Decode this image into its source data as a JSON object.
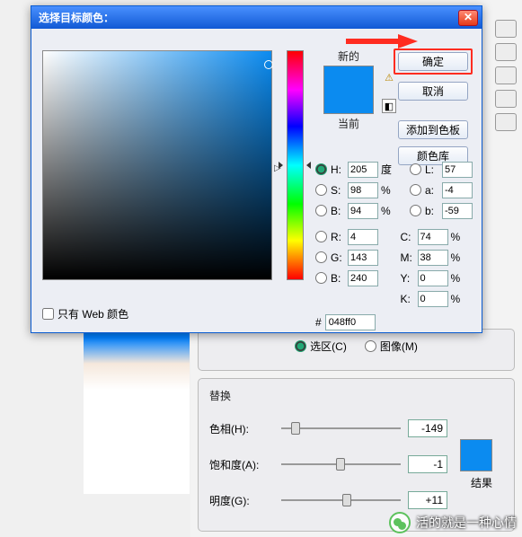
{
  "dialog": {
    "title": "选择目标颜色：",
    "ok": "确定",
    "cancel": "取消",
    "add_swatch": "添加到色板",
    "color_lib": "颜色库",
    "new_label": "新的",
    "current_label": "当前",
    "web_only": "只有 Web 颜色",
    "hex_prefix": "#",
    "hex_value": "048ff0",
    "hsb": {
      "h": {
        "label": "H:",
        "value": "205",
        "unit": "度"
      },
      "s": {
        "label": "S:",
        "value": "98",
        "unit": "%"
      },
      "b": {
        "label": "B:",
        "value": "94",
        "unit": "%"
      }
    },
    "lab": {
      "l": {
        "label": "L:",
        "value": "57"
      },
      "a": {
        "label": "a:",
        "value": "-4"
      },
      "b": {
        "label": "b:",
        "value": "-59"
      }
    },
    "rgb": {
      "r": {
        "label": "R:",
        "value": "4"
      },
      "g": {
        "label": "G:",
        "value": "143"
      },
      "b": {
        "label": "B:",
        "value": "240"
      }
    },
    "cmyk": {
      "c": {
        "label": "C:",
        "value": "74",
        "unit": "%"
      },
      "m": {
        "label": "M:",
        "value": "38",
        "unit": "%"
      },
      "y": {
        "label": "Y:",
        "value": "0",
        "unit": "%"
      },
      "k": {
        "label": "K:",
        "value": "0",
        "unit": "%"
      }
    }
  },
  "bottom_panel": {
    "selection_label": "选区(C)",
    "image_label": "图像(M)",
    "replace_title": "替换",
    "hue": {
      "label": "色相(H):",
      "value": "-149"
    },
    "sat": {
      "label": "饱和度(A):",
      "value": "-1"
    },
    "light": {
      "label": "明度(G):",
      "value": "+11"
    },
    "result_label": "结果"
  },
  "watermark": "活的就是一种心情"
}
